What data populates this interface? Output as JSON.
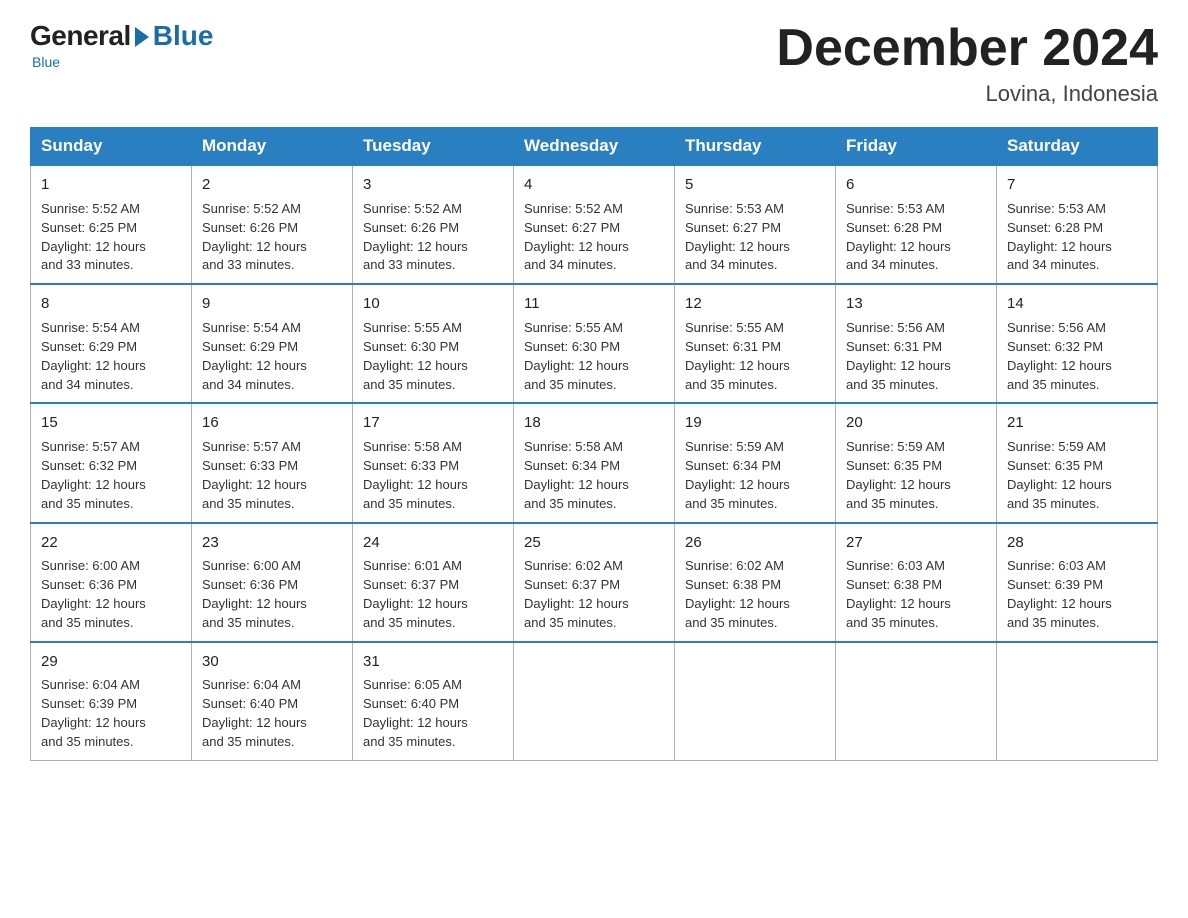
{
  "logo": {
    "general": "General",
    "blue": "Blue",
    "tagline": "Blue"
  },
  "header": {
    "month": "December 2024",
    "location": "Lovina, Indonesia"
  },
  "days_of_week": [
    "Sunday",
    "Monday",
    "Tuesday",
    "Wednesday",
    "Thursday",
    "Friday",
    "Saturday"
  ],
  "weeks": [
    [
      {
        "day": "1",
        "sunrise": "5:52 AM",
        "sunset": "6:25 PM",
        "daylight": "12 hours and 33 minutes."
      },
      {
        "day": "2",
        "sunrise": "5:52 AM",
        "sunset": "6:26 PM",
        "daylight": "12 hours and 33 minutes."
      },
      {
        "day": "3",
        "sunrise": "5:52 AM",
        "sunset": "6:26 PM",
        "daylight": "12 hours and 33 minutes."
      },
      {
        "day": "4",
        "sunrise": "5:52 AM",
        "sunset": "6:27 PM",
        "daylight": "12 hours and 34 minutes."
      },
      {
        "day": "5",
        "sunrise": "5:53 AM",
        "sunset": "6:27 PM",
        "daylight": "12 hours and 34 minutes."
      },
      {
        "day": "6",
        "sunrise": "5:53 AM",
        "sunset": "6:28 PM",
        "daylight": "12 hours and 34 minutes."
      },
      {
        "day": "7",
        "sunrise": "5:53 AM",
        "sunset": "6:28 PM",
        "daylight": "12 hours and 34 minutes."
      }
    ],
    [
      {
        "day": "8",
        "sunrise": "5:54 AM",
        "sunset": "6:29 PM",
        "daylight": "12 hours and 34 minutes."
      },
      {
        "day": "9",
        "sunrise": "5:54 AM",
        "sunset": "6:29 PM",
        "daylight": "12 hours and 34 minutes."
      },
      {
        "day": "10",
        "sunrise": "5:55 AM",
        "sunset": "6:30 PM",
        "daylight": "12 hours and 35 minutes."
      },
      {
        "day": "11",
        "sunrise": "5:55 AM",
        "sunset": "6:30 PM",
        "daylight": "12 hours and 35 minutes."
      },
      {
        "day": "12",
        "sunrise": "5:55 AM",
        "sunset": "6:31 PM",
        "daylight": "12 hours and 35 minutes."
      },
      {
        "day": "13",
        "sunrise": "5:56 AM",
        "sunset": "6:31 PM",
        "daylight": "12 hours and 35 minutes."
      },
      {
        "day": "14",
        "sunrise": "5:56 AM",
        "sunset": "6:32 PM",
        "daylight": "12 hours and 35 minutes."
      }
    ],
    [
      {
        "day": "15",
        "sunrise": "5:57 AM",
        "sunset": "6:32 PM",
        "daylight": "12 hours and 35 minutes."
      },
      {
        "day": "16",
        "sunrise": "5:57 AM",
        "sunset": "6:33 PM",
        "daylight": "12 hours and 35 minutes."
      },
      {
        "day": "17",
        "sunrise": "5:58 AM",
        "sunset": "6:33 PM",
        "daylight": "12 hours and 35 minutes."
      },
      {
        "day": "18",
        "sunrise": "5:58 AM",
        "sunset": "6:34 PM",
        "daylight": "12 hours and 35 minutes."
      },
      {
        "day": "19",
        "sunrise": "5:59 AM",
        "sunset": "6:34 PM",
        "daylight": "12 hours and 35 minutes."
      },
      {
        "day": "20",
        "sunrise": "5:59 AM",
        "sunset": "6:35 PM",
        "daylight": "12 hours and 35 minutes."
      },
      {
        "day": "21",
        "sunrise": "5:59 AM",
        "sunset": "6:35 PM",
        "daylight": "12 hours and 35 minutes."
      }
    ],
    [
      {
        "day": "22",
        "sunrise": "6:00 AM",
        "sunset": "6:36 PM",
        "daylight": "12 hours and 35 minutes."
      },
      {
        "day": "23",
        "sunrise": "6:00 AM",
        "sunset": "6:36 PM",
        "daylight": "12 hours and 35 minutes."
      },
      {
        "day": "24",
        "sunrise": "6:01 AM",
        "sunset": "6:37 PM",
        "daylight": "12 hours and 35 minutes."
      },
      {
        "day": "25",
        "sunrise": "6:02 AM",
        "sunset": "6:37 PM",
        "daylight": "12 hours and 35 minutes."
      },
      {
        "day": "26",
        "sunrise": "6:02 AM",
        "sunset": "6:38 PM",
        "daylight": "12 hours and 35 minutes."
      },
      {
        "day": "27",
        "sunrise": "6:03 AM",
        "sunset": "6:38 PM",
        "daylight": "12 hours and 35 minutes."
      },
      {
        "day": "28",
        "sunrise": "6:03 AM",
        "sunset": "6:39 PM",
        "daylight": "12 hours and 35 minutes."
      }
    ],
    [
      {
        "day": "29",
        "sunrise": "6:04 AM",
        "sunset": "6:39 PM",
        "daylight": "12 hours and 35 minutes."
      },
      {
        "day": "30",
        "sunrise": "6:04 AM",
        "sunset": "6:40 PM",
        "daylight": "12 hours and 35 minutes."
      },
      {
        "day": "31",
        "sunrise": "6:05 AM",
        "sunset": "6:40 PM",
        "daylight": "12 hours and 35 minutes."
      },
      null,
      null,
      null,
      null
    ]
  ],
  "labels": {
    "sunrise": "Sunrise:",
    "sunset": "Sunset:",
    "daylight": "Daylight:"
  }
}
